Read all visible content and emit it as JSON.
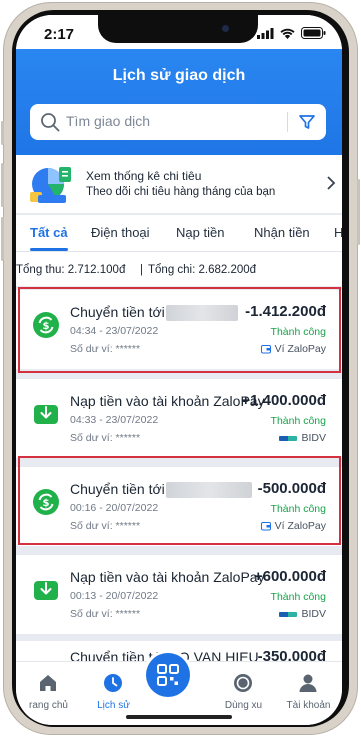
{
  "status_bar": {
    "time": "2:17"
  },
  "header": {
    "title": "Lịch sử giao dịch",
    "search_placeholder": "Tìm giao dịch"
  },
  "promo": {
    "title": "Xem thống kê chi tiêu",
    "subtitle": "Theo dõi chi tiêu hàng tháng của bạn"
  },
  "tabs": [
    "Tất cả",
    "Điện thoại",
    "Nạp tiền",
    "Nhận tiền",
    "H"
  ],
  "summary": {
    "income": "Tổng thu: 2.712.100đ",
    "separator": "|",
    "expense": "Tổng chi: 2.682.200đ"
  },
  "transactions": [
    {
      "title": "Chuyển tiền tới",
      "amount": "-1.412.200đ",
      "datetime": "04:34 - 23/07/2022",
      "status": "Thành công",
      "balance": "Số dư ví: ******",
      "source": "Ví ZaloPay",
      "icon": "transfer-icon"
    },
    {
      "title": "Nạp tiền vào tài khoản ZaloPay",
      "amount": "+1.400.000đ",
      "datetime": "04:33 - 23/07/2022",
      "status": "Thành công",
      "balance": "Số dư ví: ******",
      "source": "BIDV",
      "icon": "topup-icon"
    },
    {
      "title": "Chuyển tiền tới",
      "amount": "-500.000đ",
      "datetime": "00:16 - 20/07/2022",
      "status": "Thành công",
      "balance": "Số dư ví: ******",
      "source": "Ví ZaloPay",
      "icon": "transfer-icon"
    },
    {
      "title": "Nạp tiền vào tài khoản ZaloPay",
      "amount": "+600.000đ",
      "datetime": "00:13 - 20/07/2022",
      "status": "Thành công",
      "balance": "Số dư ví: ******",
      "source": "BIDV",
      "icon": "topup-icon"
    },
    {
      "title": "Chuyển tiền tới DO VAN HIEU",
      "amount": "-350.000đ"
    }
  ],
  "bottom_nav": [
    "rang chủ",
    "Lịch sử",
    "",
    "Dùng xu",
    "Tài khoản"
  ],
  "colors": {
    "primary": "#1f72e4",
    "success": "#17a34a",
    "highlight": "#d5303f",
    "icon_green": "#20b14a"
  }
}
